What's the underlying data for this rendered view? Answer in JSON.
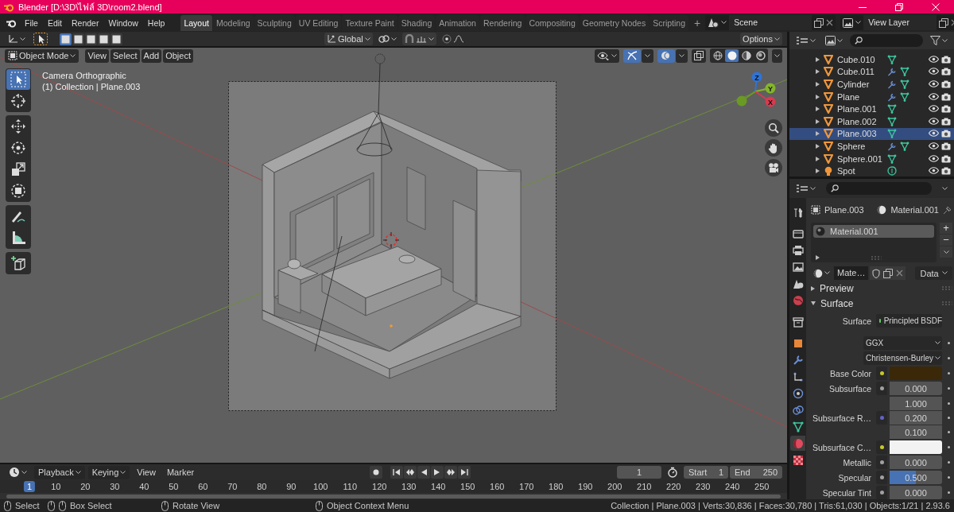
{
  "window": {
    "title": "Blender [D:\\3D\\ไฟล์ 3D\\room2.blend]"
  },
  "menu": [
    "File",
    "Edit",
    "Render",
    "Window",
    "Help"
  ],
  "workspaces": [
    {
      "label": "Layout",
      "selected": true
    },
    {
      "label": "Modeling",
      "selected": false
    },
    {
      "label": "Sculpting",
      "selected": false
    },
    {
      "label": "UV Editing",
      "selected": false
    },
    {
      "label": "Texture Paint",
      "selected": false
    },
    {
      "label": "Shading",
      "selected": false
    },
    {
      "label": "Animation",
      "selected": false
    },
    {
      "label": "Rendering",
      "selected": false
    },
    {
      "label": "Compositing",
      "selected": false
    },
    {
      "label": "Geometry Nodes",
      "selected": false
    },
    {
      "label": "Scripting",
      "selected": false
    }
  ],
  "add_workspace": "+",
  "scene": "Scene",
  "view_layer": "View Layer",
  "tool_settings": {
    "select_modes": [
      {
        "selected": true
      },
      {
        "selected": false
      },
      {
        "selected": false
      },
      {
        "selected": false
      },
      {
        "selected": false
      }
    ],
    "orientation": "Global",
    "snap": false,
    "options": "Options"
  },
  "viewport": {
    "mode": "Object Mode",
    "menus": [
      "View",
      "Select",
      "Add",
      "Object"
    ],
    "shading": [
      {
        "kind": "wireframe",
        "selected": false
      },
      {
        "kind": "solid",
        "selected": true
      },
      {
        "kind": "material",
        "selected": false
      },
      {
        "kind": "rendered",
        "selected": false
      }
    ],
    "info": [
      "Camera Orthographic",
      "(1) Collection | Plane.003"
    ],
    "tool_groups": [
      [
        {
          "kind": "select_box",
          "selected": true
        },
        {
          "kind": "cursor",
          "selected": false
        }
      ],
      [
        {
          "kind": "move",
          "selected": false
        },
        {
          "kind": "rotate",
          "selected": false
        },
        {
          "kind": "scale",
          "selected": false
        },
        {
          "kind": "transform",
          "selected": false
        }
      ],
      [
        {
          "kind": "annotate",
          "selected": false
        },
        {
          "kind": "measure",
          "selected": false
        }
      ],
      [
        {
          "kind": "add_cube",
          "selected": false
        }
      ]
    ],
    "gizmos": true,
    "overlays": true,
    "gizmo": {
      "z": "Z",
      "y": "Y",
      "x": "X"
    }
  },
  "outliner": {
    "rows": [
      {
        "name": "Cube.010",
        "kind": "mesh",
        "modifier": false,
        "selected": false
      },
      {
        "name": "Cube.011",
        "kind": "mesh",
        "modifier": true,
        "selected": false
      },
      {
        "name": "Cylinder",
        "kind": "mesh",
        "modifier": true,
        "selected": false
      },
      {
        "name": "Plane",
        "kind": "mesh",
        "modifier": true,
        "selected": false
      },
      {
        "name": "Plane.001",
        "kind": "mesh",
        "modifier": false,
        "selected": false
      },
      {
        "name": "Plane.002",
        "kind": "mesh",
        "modifier": false,
        "selected": false
      },
      {
        "name": "Plane.003",
        "kind": "mesh",
        "modifier": false,
        "selected": true
      },
      {
        "name": "Sphere",
        "kind": "mesh",
        "modifier": true,
        "selected": false
      },
      {
        "name": "Sphere.001",
        "kind": "mesh",
        "modifier": false,
        "selected": false
      },
      {
        "name": "Spot",
        "kind": "light",
        "modifier": false,
        "selected": false
      }
    ]
  },
  "properties": {
    "tabs": [
      {
        "kind": "tool",
        "selected": false
      },
      {
        "kind": "render",
        "selected": false
      },
      {
        "kind": "output",
        "selected": false
      },
      {
        "kind": "view_layer",
        "selected": false
      },
      {
        "kind": "scene",
        "selected": false
      },
      {
        "kind": "world",
        "selected": false
      },
      {
        "kind": "collection",
        "selected": false
      },
      {
        "kind": "object",
        "selected": false
      },
      {
        "kind": "modifiers",
        "selected": false
      },
      {
        "kind": "particles",
        "selected": false
      },
      {
        "kind": "physics",
        "selected": false
      },
      {
        "kind": "constraints",
        "selected": false
      },
      {
        "kind": "data",
        "selected": false
      },
      {
        "kind": "material",
        "selected": true
      },
      {
        "kind": "texture",
        "selected": false
      }
    ],
    "object": "Plane.003",
    "material": "Material.001",
    "slots": [
      {
        "name": "Material.001",
        "selected": true
      }
    ],
    "slot_buttons": [
      "+",
      "−"
    ],
    "datablock": {
      "name": "Mate…",
      "link": "Data"
    },
    "panels": [
      {
        "title": "Preview",
        "expanded": false
      },
      {
        "title": "Surface",
        "expanded": true
      }
    ],
    "inputs": [
      {
        "kind": "link",
        "label": "Surface",
        "value": "Principled BSDF",
        "socket": {
          "color": "#63c763"
        }
      },
      {
        "kind": "dropdown",
        "value": "GGX"
      },
      {
        "kind": "dropdown",
        "value": "Christensen-Burley"
      },
      {
        "kind": "color",
        "label": "Base Color",
        "socket": {
          "color": "#c7c729"
        },
        "color": "#3a2808"
      },
      {
        "kind": "slider",
        "label": "Subsurface",
        "socket": {
          "color": "#a1a1a1"
        },
        "value": "0.000",
        "level": 0
      },
      {
        "kind": "vector",
        "label": "Subsurface R…",
        "socket": {
          "color": "#6363c7"
        },
        "values": [
          "1.000",
          "0.200",
          "0.100"
        ]
      },
      {
        "kind": "color",
        "label": "Subsurface C…",
        "socket": {
          "color": "#c7c729"
        },
        "color": "#f2f2f2"
      },
      {
        "kind": "slider",
        "label": "Metallic",
        "socket": {
          "color": "#a1a1a1"
        },
        "value": "0.000",
        "level": 0
      },
      {
        "kind": "slider",
        "label": "Specular",
        "socket": {
          "color": "#a1a1a1"
        },
        "value": "0.500",
        "level": 0.5
      },
      {
        "kind": "slider",
        "label": "Specular Tint",
        "socket": {
          "color": "#a1a1a1"
        },
        "value": "0.000",
        "level": 0
      }
    ]
  },
  "timeline": {
    "menus": [
      {
        "label": "Playback",
        "dropdown": true
      },
      {
        "label": "Keying",
        "dropdown": true
      },
      {
        "label": "View",
        "dropdown": false
      },
      {
        "label": "Marker",
        "dropdown": false
      }
    ],
    "current_frame": "1",
    "start_label": "Start",
    "start": "1",
    "end_label": "End",
    "end": "250",
    "ruler": [
      {
        "label": "1",
        "current": true
      },
      {
        "label": "10",
        "current": false
      },
      {
        "label": "20",
        "current": false
      },
      {
        "label": "30",
        "current": false
      },
      {
        "label": "40",
        "current": false
      },
      {
        "label": "50",
        "current": false
      },
      {
        "label": "60",
        "current": false
      },
      {
        "label": "70",
        "current": false
      },
      {
        "label": "80",
        "current": false
      },
      {
        "label": "90",
        "current": false
      },
      {
        "label": "100",
        "current": false
      },
      {
        "label": "110",
        "current": false
      },
      {
        "label": "120",
        "current": false
      },
      {
        "label": "130",
        "current": false
      },
      {
        "label": "140",
        "current": false
      },
      {
        "label": "150",
        "current": false
      },
      {
        "label": "160",
        "current": false
      },
      {
        "label": "170",
        "current": false
      },
      {
        "label": "180",
        "current": false
      },
      {
        "label": "190",
        "current": false
      },
      {
        "label": "200",
        "current": false
      },
      {
        "label": "210",
        "current": false
      },
      {
        "label": "220",
        "current": false
      },
      {
        "label": "230",
        "current": false
      },
      {
        "label": "240",
        "current": false
      },
      {
        "label": "250",
        "current": false
      }
    ]
  },
  "status_bar": {
    "hints": [
      {
        "kind": "left",
        "label": "Select"
      },
      {
        "kind": "drag",
        "label": "Box Select"
      },
      {
        "kind": "middle",
        "label": "Rotate View"
      },
      {
        "kind": "right",
        "label": "Object Context Menu"
      }
    ],
    "stats": "Collection | Plane.003 | Verts:30,836 | Faces:30,780 | Tris:61,030 | Objects:1/21 | 2.93.6"
  }
}
